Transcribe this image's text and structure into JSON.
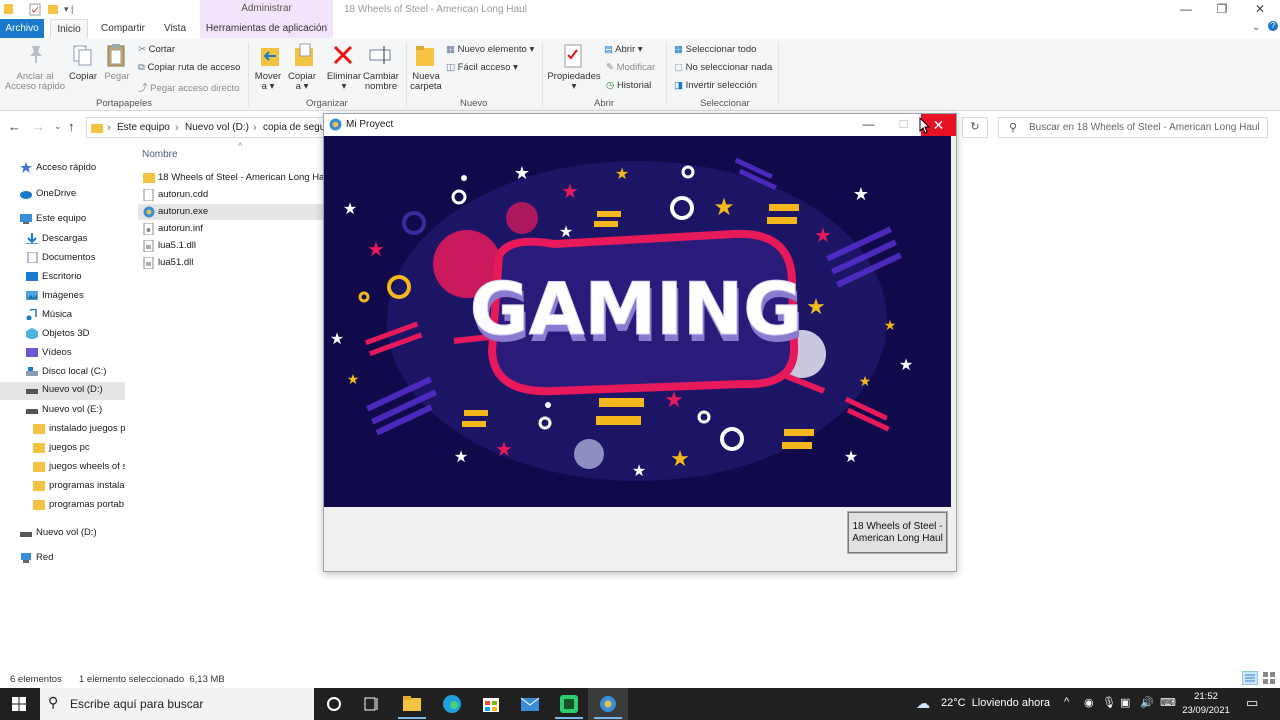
{
  "explorer": {
    "window_title": "18 Wheels of Steel - American Long Haul",
    "contextual_tab_group": "Administrar",
    "tabs": [
      "Archivo",
      "Inicio",
      "Compartir",
      "Vista",
      "Herramientas de aplicación"
    ],
    "ribbon": {
      "portapapeles": {
        "group_label": "Portapapeles",
        "anclar_label_1": "Anclar al",
        "anclar_label_2": "Acceso rápido",
        "copiar": "Copiar",
        "pegar": "Pegar",
        "cortar": "Cortar",
        "copiar_ruta": "Copiar ruta de acceso",
        "pegar_acceso": "Pegar acceso directo"
      },
      "organizar": {
        "group_label": "Organizar",
        "mover_1": "Mover",
        "mover_2": "a",
        "copiar_1": "Copiar",
        "copiar_2": "a",
        "eliminar": "Eliminar",
        "cambiar_1": "Cambiar",
        "cambiar_2": "nombre"
      },
      "nuevo": {
        "group_label": "Nuevo",
        "carpeta_1": "Nueva",
        "carpeta_2": "carpeta",
        "nuevo_elemento": "Nuevo elemento",
        "facil_acceso": "Fácil acceso"
      },
      "abrir": {
        "group_label": "Abrir",
        "propiedades": "Propiedades",
        "abrir": "Abrir",
        "modificar": "Modificar",
        "historial": "Historial"
      },
      "seleccionar": {
        "group_label": "Seleccionar",
        "todo": "Seleccionar todo",
        "nada": "No seleccionar nada",
        "invertir": "Invertir selección"
      }
    },
    "breadcrumbs": [
      "Este equipo",
      "Nuevo vol (D:)",
      "copia de segur"
    ],
    "search_placeholder": "Buscar en 18 Wheels of Steel - American Long Haul",
    "nav_pane": [
      {
        "label": "Acceso rápido",
        "icon": "star-icon"
      },
      {
        "label": "OneDrive",
        "icon": "cloud-icon"
      },
      {
        "label": "Este equipo",
        "icon": "computer-icon"
      },
      {
        "label": "Descargas",
        "icon": "download-icon"
      },
      {
        "label": "Documentos",
        "icon": "document-icon"
      },
      {
        "label": "Escritorio",
        "icon": "desktop-icon"
      },
      {
        "label": "Imágenes",
        "icon": "image-icon"
      },
      {
        "label": "Música",
        "icon": "music-icon"
      },
      {
        "label": "Objetos 3D",
        "icon": "cube-icon"
      },
      {
        "label": "Vídeos",
        "icon": "video-icon"
      },
      {
        "label": "Disco local (C:)",
        "icon": "drive-icon"
      },
      {
        "label": "Nuevo vol (D:)",
        "icon": "drive-icon"
      },
      {
        "label": "Nuevo vol (E:)",
        "icon": "drive-icon"
      },
      {
        "label": "instalado juegos p",
        "icon": "folder-icon"
      },
      {
        "label": "juegos pc",
        "icon": "folder-icon"
      },
      {
        "label": "juegos wheels of s",
        "icon": "folder-icon"
      },
      {
        "label": "programas instala",
        "icon": "folder-icon"
      },
      {
        "label": "programas portab",
        "icon": "folder-icon"
      },
      {
        "label": "Nuevo vol (D:)",
        "icon": "drive-icon"
      },
      {
        "label": "Red",
        "icon": "network-icon"
      }
    ],
    "column_header": "Nombre",
    "files": [
      {
        "name": "18 Wheels of Steel - American Long Haul",
        "icon": "folder-icon"
      },
      {
        "name": "autorun.cdd",
        "icon": "file-icon"
      },
      {
        "name": "autorun.exe",
        "icon": "app-icon"
      },
      {
        "name": "autorun.inf",
        "icon": "settings-file-icon"
      },
      {
        "name": "lua5.1.dll",
        "icon": "dll-icon"
      },
      {
        "name": "lua51.dll",
        "icon": "dll-icon"
      }
    ],
    "status": {
      "count": "6 elementos",
      "selection": "1 elemento seleccionado  6,13 MB"
    }
  },
  "dialog": {
    "title": "Mi Proyect",
    "banner_text": "GAMING",
    "launch_button": "18 Wheels of Steel - American Long Haul",
    "close_glyph": "✕",
    "minimize_glyph": "—",
    "maximize_glyph": "☐"
  },
  "taskbar": {
    "search_placeholder": "Escribe aquí para buscar",
    "weather": "22°C  Lloviendo ahora",
    "time": "21:52",
    "date": "23/09/2021"
  },
  "colors": {
    "accent": "#1979ca",
    "close_red": "#e81123",
    "banner_bg": "#100a4a",
    "banner_frame": "#e8195a",
    "star_yellow": "#f4b81c"
  }
}
